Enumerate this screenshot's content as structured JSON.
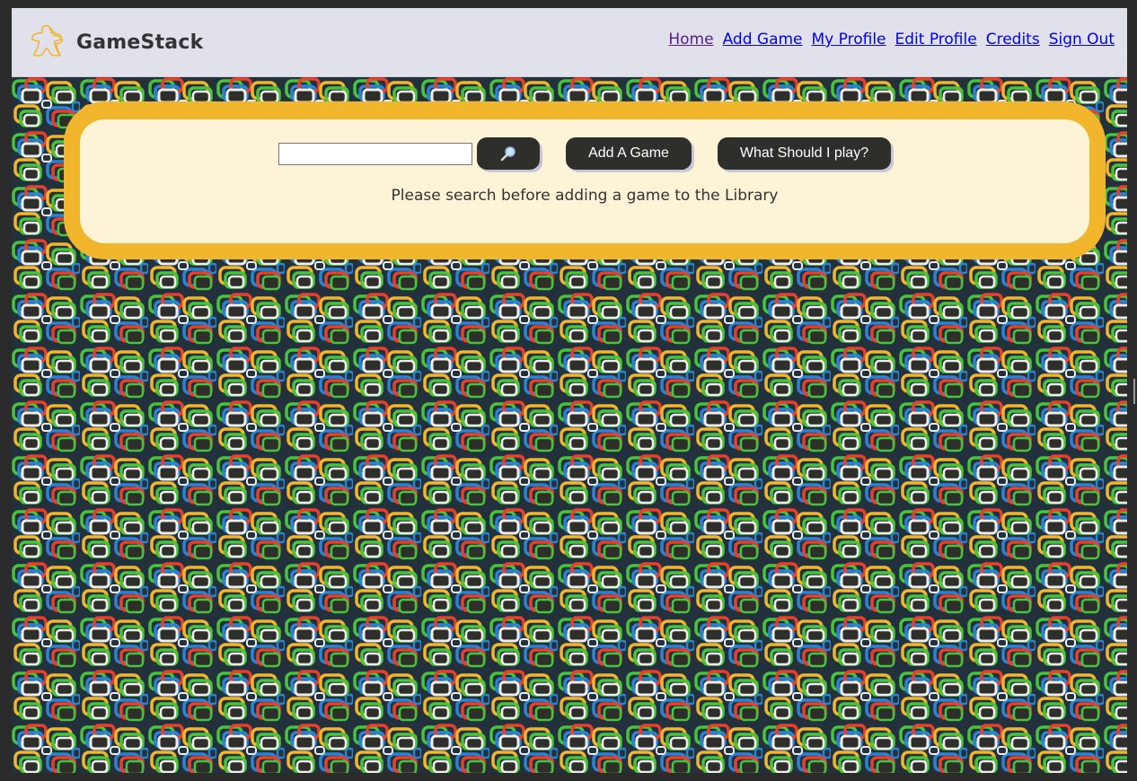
{
  "brand": {
    "name": "GameStack",
    "logo_icon": "meeple-icon",
    "logo_color": "#f1b62c"
  },
  "nav": {
    "links": [
      {
        "label": "Home",
        "visited": true
      },
      {
        "label": "Add Game",
        "visited": false
      },
      {
        "label": "My Profile",
        "visited": false
      },
      {
        "label": "Edit Profile",
        "visited": false
      },
      {
        "label": "Credits",
        "visited": false
      },
      {
        "label": "Sign Out",
        "visited": false
      }
    ]
  },
  "search": {
    "input_value": "",
    "search_button_icon": "magnifier-icon",
    "add_button_label": "Add A Game",
    "play_button_label": "What Should I play?",
    "message": "Please search before adding a game to the Library"
  },
  "colors": {
    "navbar": "#e1e1ec",
    "panel_border": "#f1b62c",
    "panel_fill": "#fdf3d6",
    "button": "#2e2e2a",
    "link": "#0000ee",
    "link_visited": "#551a8b",
    "pattern": [
      "#2e2e2a",
      "#48c43c",
      "#2a84d6",
      "#e8402a",
      "#f1b62c",
      "#eeeeee"
    ]
  }
}
